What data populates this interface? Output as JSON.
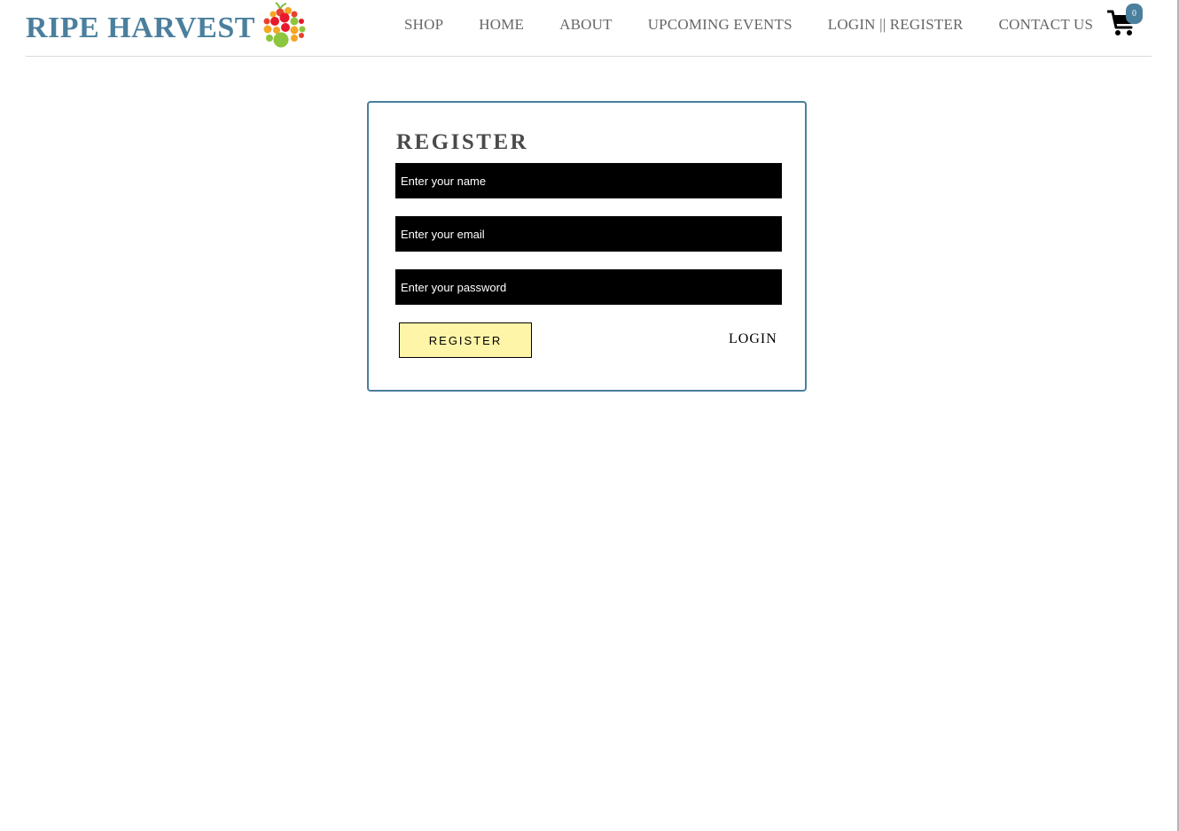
{
  "header": {
    "brand_name": "RIPE HARVEST",
    "logo_icon": "fruit-cluster-logo",
    "nav": [
      {
        "label": "SHOP"
      },
      {
        "label": "HOME"
      },
      {
        "label": "ABOUT"
      },
      {
        "label": "UPCOMING EVENTS"
      },
      {
        "label": "LOGIN || REGISTER"
      },
      {
        "label": "CONTACT US"
      }
    ],
    "cart": {
      "icon": "shopping-cart-icon",
      "count": "0"
    }
  },
  "register_form": {
    "title": "REGISTER",
    "name_placeholder": "Enter your name",
    "name_value": "",
    "email_placeholder": "Enter your email",
    "email_value": "",
    "password_placeholder": "Enter your password",
    "password_value": "",
    "register_label": "REGISTER",
    "login_label": "LOGIN"
  },
  "colors": {
    "brand": "#4a7f9d",
    "nav_text": "#666666",
    "input_bg": "#000000",
    "button_bg": "#fff5a9",
    "card_border": "#4a7f9d"
  }
}
